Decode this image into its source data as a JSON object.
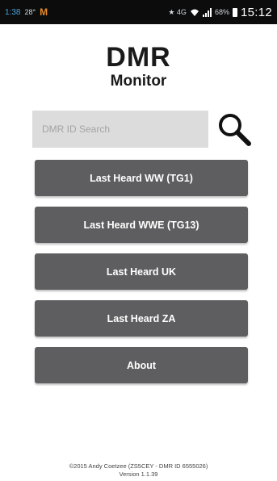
{
  "status_bar": {
    "left_time_small": "1:38",
    "left_temp": "28°",
    "left_badge": "M",
    "right_indicators": "★ 4G",
    "battery_percent": "68%",
    "time": "15:12"
  },
  "logo": {
    "title": "DMR",
    "subtitle": "Monitor"
  },
  "search": {
    "placeholder": "DMR ID Search"
  },
  "buttons": [
    {
      "label": "Last Heard WW (TG1)"
    },
    {
      "label": "Last Heard WWE (TG13)"
    },
    {
      "label": "Last Heard UK"
    },
    {
      "label": "Last Heard ZA"
    },
    {
      "label": "About"
    }
  ],
  "footer": {
    "copyright": "©2015 Andy Coetzee (ZS5CEY - DMR ID 6555026)",
    "version": "Version 1.1.39"
  },
  "colors": {
    "status_bar_bg": "#0c0c0c",
    "button_bg": "#5e5e60",
    "search_bg": "#dcdcdc",
    "text_dark": "#1a1a1a"
  }
}
